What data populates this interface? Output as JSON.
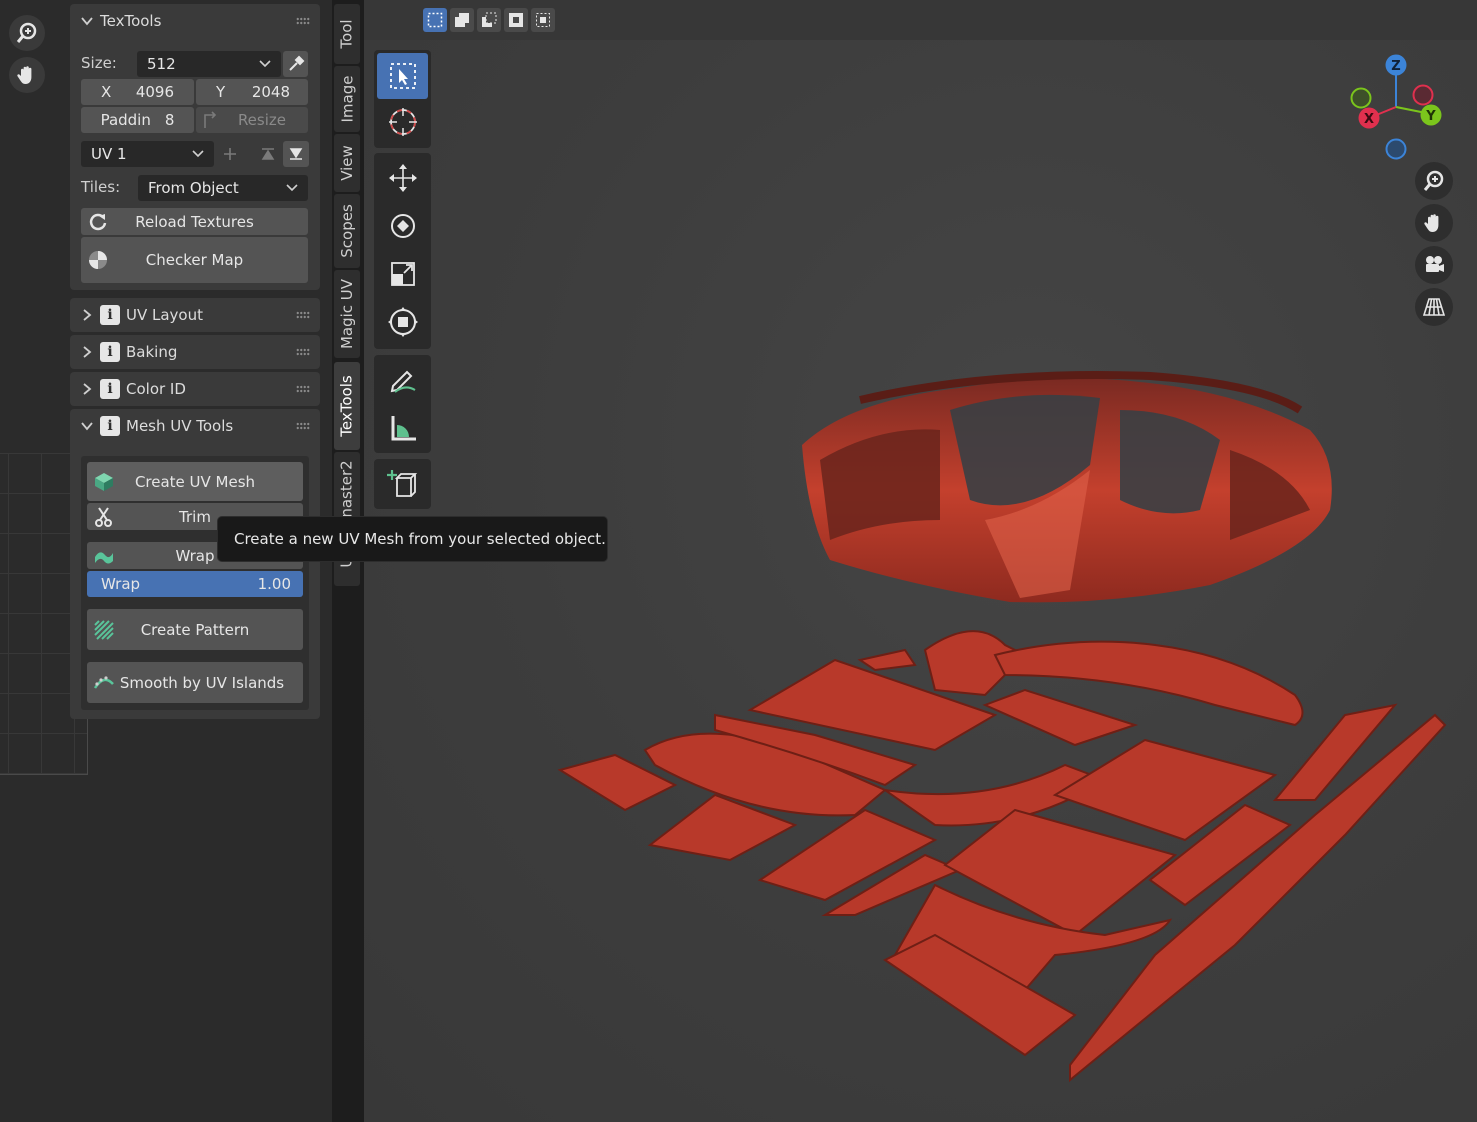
{
  "colors": {
    "accent": "#4772b3",
    "panel": "#3a3a3a",
    "mesh": "#b8392a",
    "tooltip_bg": "#191919"
  },
  "textools": {
    "title": "TexTools",
    "size_label": "Size:",
    "size_value": "512",
    "x_label": "X",
    "x_value": "4096",
    "y_label": "Y",
    "y_value": "2048",
    "padding_label": "Paddin",
    "padding_value": "8",
    "resize_label": "Resize",
    "uv_channel": "UV 1",
    "tiles_label": "Tiles:",
    "tiles_value": "From Object",
    "reload_textures": "Reload Textures",
    "checker_map": "Checker Map"
  },
  "collapsed_panels": [
    {
      "label": "UV Layout"
    },
    {
      "label": "Baking"
    },
    {
      "label": "Color ID"
    }
  ],
  "mesh_uv_tools": {
    "title": "Mesh UV Tools",
    "create_uv_mesh": "Create UV Mesh",
    "trim": "Trim",
    "wrap_button": "Wrap",
    "wrap_slider_label": "Wrap",
    "wrap_slider_value": "1.00",
    "create_pattern": "Create Pattern",
    "smooth_by_uv_islands": "Smooth by UV Islands"
  },
  "tooltip": "Create a new UV Mesh from your selected object.",
  "side_tabs": [
    "Tool",
    "Image",
    "View",
    "Scopes",
    "Magic UV",
    "TexTools",
    "naster2",
    "UV"
  ],
  "active_tab": "TexTools",
  "gizmo": {
    "z": "Z",
    "x": "X",
    "y": "Y"
  }
}
